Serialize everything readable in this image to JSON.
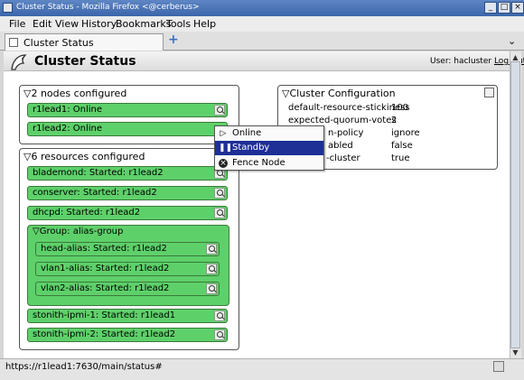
{
  "window": {
    "title": "Cluster Status - Mozilla Firefox <@cerberus>",
    "controls": [
      "minimize",
      "maximize",
      "close"
    ]
  },
  "menubar": [
    "File",
    "Edit",
    "View",
    "History",
    "Bookmarks",
    "Tools",
    "Help"
  ],
  "tab": {
    "label": "Cluster Status"
  },
  "page": {
    "title": "Cluster Status",
    "user_label": "User: hacluster",
    "logout": "Log Out"
  },
  "nodes": {
    "header": "2 nodes configured",
    "items": [
      "r1lead1: Online",
      "r1lead2: Online"
    ]
  },
  "resources": {
    "header": "6 resources configured",
    "items": [
      "blademond: Started: r1lead2",
      "conserver: Started: r1lead2",
      "dhcpd: Started: r1lead2"
    ],
    "group": {
      "header": "Group: alias-group",
      "items": [
        "head-alias: Started: r1lead2",
        "vlan1-alias: Started: r1lead2",
        "vlan2-alias: Started: r1lead2"
      ]
    },
    "after_group": [
      "stonith-ipmi-1: Started: r1lead1",
      "stonith-ipmi-2: Started: r1lead2"
    ]
  },
  "config": {
    "header": "Cluster Configuration",
    "rows": [
      {
        "key": "default-resource-stickiness",
        "value": "100"
      },
      {
        "key": "expected-quorum-votes",
        "value": "2"
      },
      {
        "key": "n-policy",
        "value": "ignore"
      },
      {
        "key": "abled",
        "value": "false"
      },
      {
        "key": "-cluster",
        "value": "true"
      }
    ]
  },
  "context_menu": {
    "items": [
      {
        "label": "Online",
        "icon": "play-icon"
      },
      {
        "label": "Standby",
        "icon": "pause-icon",
        "selected": true
      },
      {
        "label": "Fence Node",
        "icon": "stop-icon"
      }
    ]
  },
  "statusbar": {
    "url": "https://r1lead1:7630/main/status#"
  },
  "colors": {
    "resource_green": "#5ed06a",
    "menu_highlight": "#1e2f96",
    "titlebar": "#3b66aa"
  }
}
